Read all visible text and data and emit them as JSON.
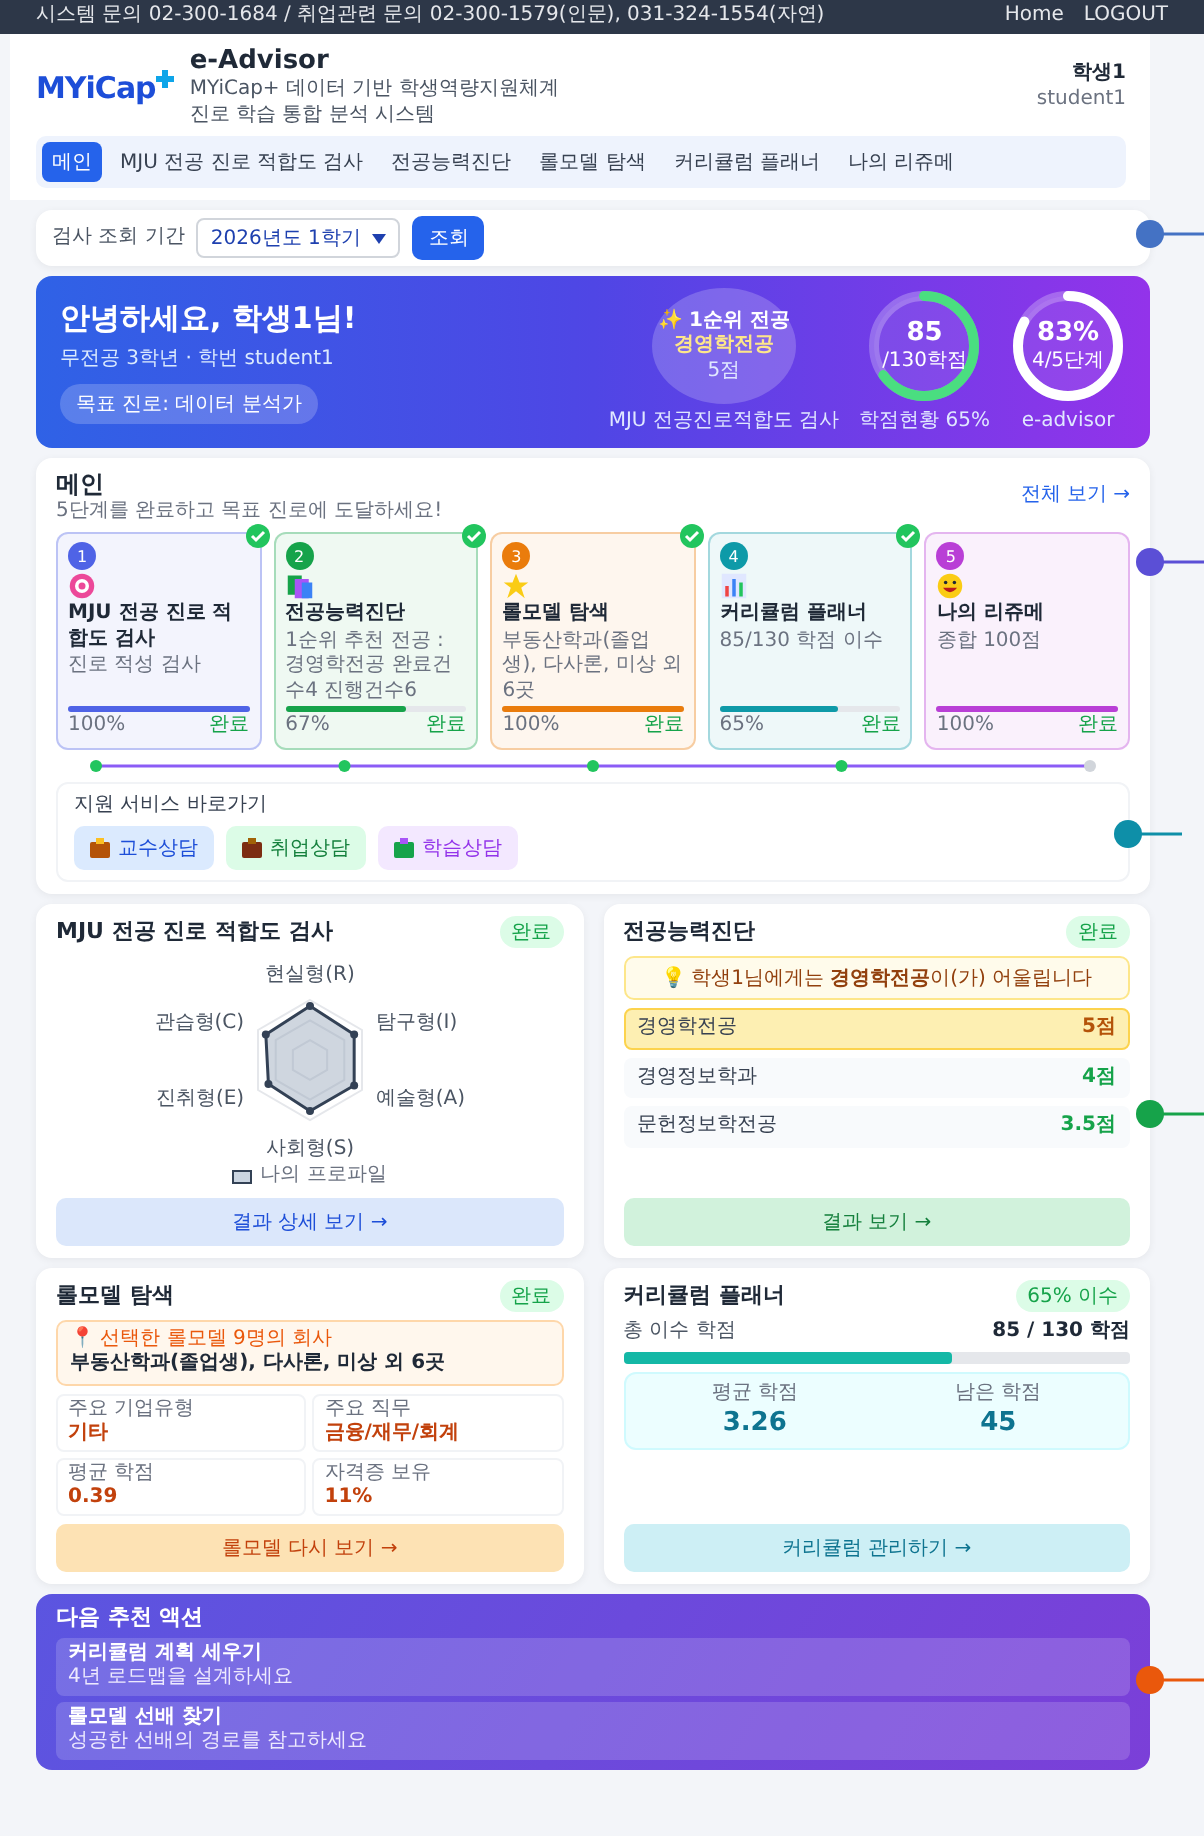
{
  "topbar": {
    "notice": "시스템 문의 02-300-1684 / 취업관련 문의 02-300-1579(인문), 031-324-1554(자연)",
    "links": [
      "Home",
      "LOGOUT"
    ]
  },
  "header": {
    "logo": "MYiCap",
    "title": "e-Advisor",
    "subtitle": [
      "MYiCap+ 데이터 기반 학생역량지원체계",
      "진로 학습 통합 분석 시스템"
    ],
    "user_name": "학생1",
    "user_id": "student1"
  },
  "nav": [
    {
      "label": "메인",
      "selected": true
    },
    {
      "label": "MJU 전공 진로 적합도 검사",
      "selected": false
    },
    {
      "label": "전공능력진단",
      "selected": false
    },
    {
      "label": "롤모델 탐색",
      "selected": false
    },
    {
      "label": "커리큘럼 플래너",
      "selected": false
    },
    {
      "label": "나의 리쥬메",
      "selected": false
    }
  ],
  "filter": {
    "label": "검사 조회 기간",
    "value": "2026년도 1학기",
    "button": "조회",
    "callout": {
      "color": "#4472c4"
    }
  },
  "hero": {
    "greeting": "안녕하세요, 학생1님!",
    "info": "무전공 3학년 · 학번 student1",
    "goal": "목표 진로: 데이터 분석가",
    "top_major": {
      "label": "✨ 1순위 전공",
      "major": "경영학전공",
      "score": "5점",
      "caption": "MJU 전공진로적합도 검사"
    },
    "rings": [
      {
        "value": "85",
        "unit": "/130학점",
        "caption": "학점현황 65%",
        "level": 0.65,
        "kind": "credit"
      },
      {
        "value": "83%",
        "unit": "4/5단계",
        "caption": "e-advisor",
        "level": 0.83,
        "kind": "progress"
      }
    ]
  },
  "main": {
    "title": "메인",
    "subtitle": "5단계를 완료하고 목표 진로에 도달하세요!",
    "link": "전체 보기 →",
    "callout": {
      "color": "#5b4fd6"
    },
    "steps": [
      {
        "number": "1",
        "title": "MJU 전공 진로 적합도 검사",
        "desc": "진로 적성 검사",
        "level": 1,
        "percent": "100%",
        "status": "완료",
        "done": true,
        "color": "#4f63e6"
      },
      {
        "number": "2",
        "title": "전공능력진단",
        "desc": "1순위 추천 전공 : 경영학전공 완료건 수4 진행건수6",
        "level": 0.67,
        "percent": "67%",
        "status": "완료",
        "done": true,
        "color": "#16a34a"
      },
      {
        "number": "3",
        "title": "롤모델 탐색",
        "desc": "부동산학과(졸업생), 다사론, 미상 외 6곳",
        "level": 1,
        "percent": "100%",
        "status": "완료",
        "done": true,
        "color": "#ea7c0c"
      },
      {
        "number": "4",
        "title": "커리큘럼 플래너",
        "desc": "85/130 학점 이수",
        "level": 0.65,
        "percent": "65%",
        "status": "완료",
        "done": true,
        "color": "#0e9aa8"
      },
      {
        "number": "5",
        "title": "나의 리쥬메",
        "desc": "종합 100점",
        "level": 1,
        "percent": "100%",
        "status": "완료",
        "done": false,
        "color": "#b93fd6"
      }
    ],
    "support": {
      "title": "지원 서비스 바로가기",
      "callout": {
        "color": "#0e8fa8"
      },
      "buttons": [
        {
          "label": "교수상담",
          "kind": "professor"
        },
        {
          "label": "취업상담",
          "kind": "job"
        },
        {
          "label": "학습상담",
          "kind": "study"
        }
      ]
    }
  },
  "fit_card": {
    "title": "MJU 전공 진로 적합도 검사",
    "badge": "완료",
    "axes": [
      "현실형(R)",
      "탐구형(I)",
      "예술형(A)",
      "사회형(S)",
      "진취형(E)",
      "관습형(C)"
    ],
    "legend": "나의 프로파일",
    "button": "결과 상세 보기 →"
  },
  "ability_card": {
    "title": "전공능력진단",
    "badge": "완료",
    "notice": "💡 학생1님에게는 **경영학전공**이(가) 어울립니다",
    "callout": {
      "color": "#16a34a"
    },
    "rows": [
      {
        "major": "경영학전공",
        "score": "5점",
        "selected": true
      },
      {
        "major": "경영정보학과",
        "score": "4점",
        "selected": false
      },
      {
        "major": "문헌정보학전공",
        "score": "3.5점",
        "selected": false
      }
    ],
    "button": "결과 보기 →"
  },
  "rolemodel_card": {
    "title": "롤모델 탐색",
    "badge": "완료",
    "company_label": "📍 선택한 롤모델 9명의 회사",
    "companies": "부동산학과(졸업생), 다사론, 미상 외 6곳",
    "stats": [
      {
        "label": "주요 기업유형",
        "value": "기타"
      },
      {
        "label": "주요 직무",
        "value": "금융/재무/회계"
      },
      {
        "label": "평균 학점",
        "value": "0.39"
      },
      {
        "label": "자격증 보유",
        "value": "11%"
      }
    ],
    "button": "롤모델 다시 보기 →"
  },
  "curriculum_card": {
    "title": "커리큘럼 플래너",
    "badge": "65% 이수",
    "credit_label": "총 이수 학점",
    "credit_value": "85 / 130 학점",
    "level": 0.65,
    "stats": [
      {
        "label": "평균 학점",
        "value": "3.26"
      },
      {
        "label": "남은 학점",
        "value": "45"
      }
    ],
    "button": "커리큘럼 관리하기 →"
  },
  "next_actions": {
    "title": "다음 추천 액션",
    "callout": {
      "color": "#ea580c"
    },
    "items": [
      {
        "title": "커리큘럼 계획 세우기",
        "desc": "4년 로드맵을 설계하세요"
      },
      {
        "title": "롤모델 선배 찾기",
        "desc": "성공한 선배의 경로를 참고하세요"
      }
    ]
  }
}
